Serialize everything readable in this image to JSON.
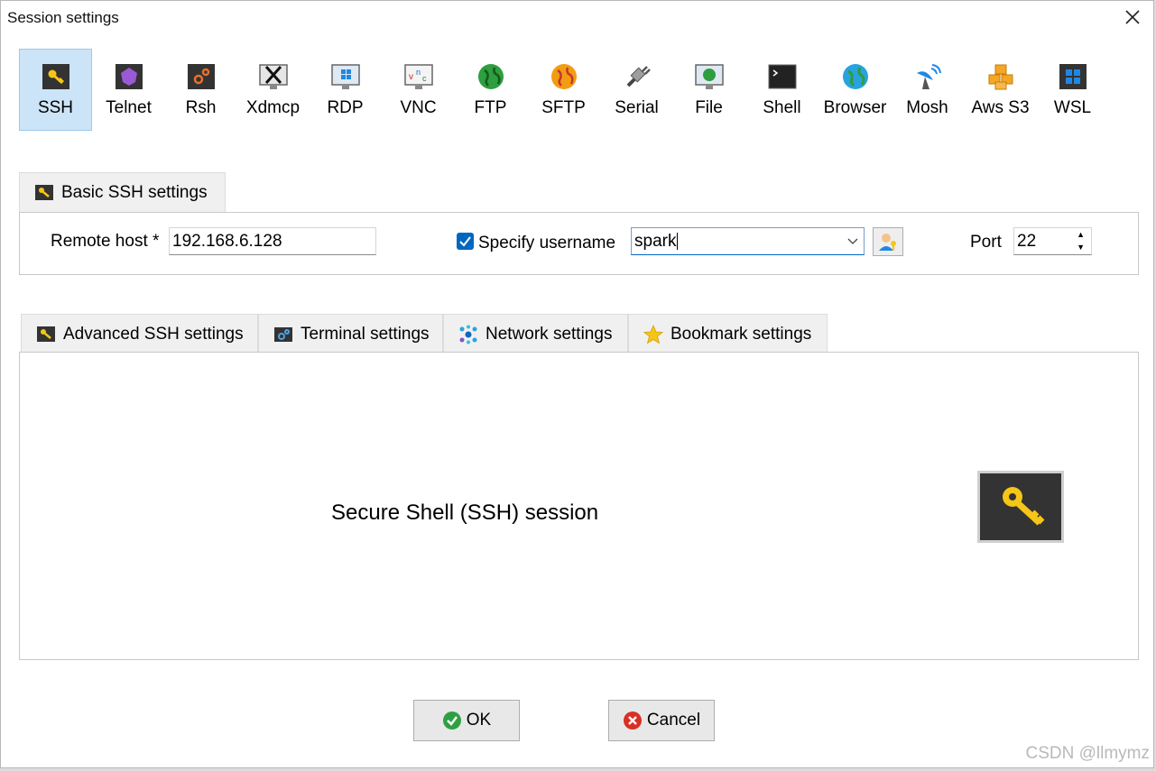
{
  "window": {
    "title": "Session settings"
  },
  "protocols": [
    {
      "label": "SSH",
      "icon": "key-icon",
      "selected": true
    },
    {
      "label": "Telnet",
      "icon": "telnet-icon"
    },
    {
      "label": "Rsh",
      "icon": "rsh-icon"
    },
    {
      "label": "Xdmcp",
      "icon": "xdmcp-icon"
    },
    {
      "label": "RDP",
      "icon": "rdp-icon"
    },
    {
      "label": "VNC",
      "icon": "vnc-icon"
    },
    {
      "label": "FTP",
      "icon": "ftp-globe-icon"
    },
    {
      "label": "SFTP",
      "icon": "sftp-globe-icon"
    },
    {
      "label": "Serial",
      "icon": "serial-plug-icon"
    },
    {
      "label": "File",
      "icon": "file-monitor-icon"
    },
    {
      "label": "Shell",
      "icon": "shell-terminal-icon"
    },
    {
      "label": "Browser",
      "icon": "browser-globe-icon"
    },
    {
      "label": "Mosh",
      "icon": "mosh-satellite-icon"
    },
    {
      "label": "Aws S3",
      "icon": "aws-s3-cubes-icon"
    },
    {
      "label": "WSL",
      "icon": "wsl-windows-icon"
    }
  ],
  "basic": {
    "tab_label": "Basic SSH settings",
    "remote_host_label": "Remote host *",
    "remote_host_value": "192.168.6.128",
    "specify_username_label": "Specify username",
    "specify_username_checked": true,
    "username_value": "spark",
    "port_label": "Port",
    "port_value": "22"
  },
  "lower_tabs": [
    {
      "label": "Advanced SSH settings",
      "icon": "key-icon"
    },
    {
      "label": "Terminal settings",
      "icon": "terminal-gear-icon"
    },
    {
      "label": "Network settings",
      "icon": "network-icon"
    },
    {
      "label": "Bookmark settings",
      "icon": "star-icon"
    }
  ],
  "panel": {
    "description": "Secure Shell (SSH) session"
  },
  "buttons": {
    "ok": "OK",
    "cancel": "Cancel"
  },
  "watermark": "CSDN @llmymz",
  "colors": {
    "selection": "#cce4f7",
    "checkbox": "#0067c0",
    "key": "#f5c518"
  }
}
